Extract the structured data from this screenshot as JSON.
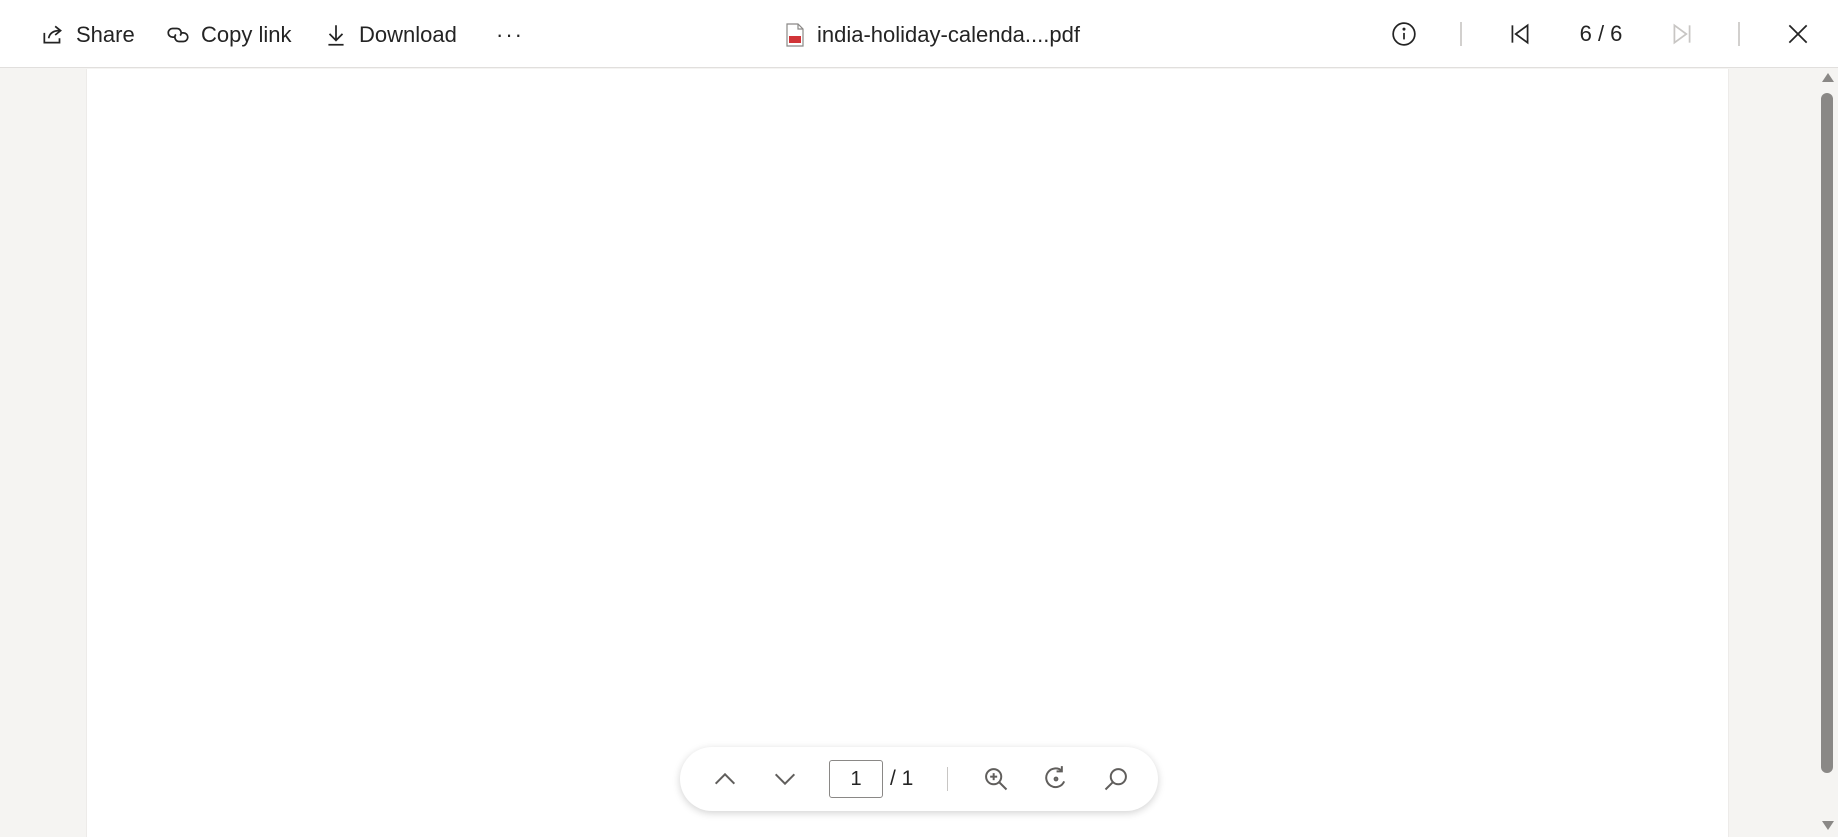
{
  "toolbar": {
    "share_label": "Share",
    "copy_link_label": "Copy link",
    "download_label": "Download",
    "more_label": "···"
  },
  "file": {
    "name": "india-holiday-calenda....pdf",
    "icon": "pdf-file-icon"
  },
  "navigation": {
    "position_text": "6 / 6",
    "info_icon": "info-icon",
    "first_icon": "first-item-icon",
    "last_icon": "last-item-icon",
    "close_icon": "close-icon"
  },
  "pdf_controls": {
    "current_page": "1",
    "total_pages": "/ 1",
    "icons": [
      "chevron-up-icon",
      "chevron-down-icon",
      "zoom-in-icon",
      "rotate-icon",
      "search-icon"
    ]
  },
  "colors": {
    "background": "#f5f4f2",
    "pdf_accent": "#d13438"
  }
}
